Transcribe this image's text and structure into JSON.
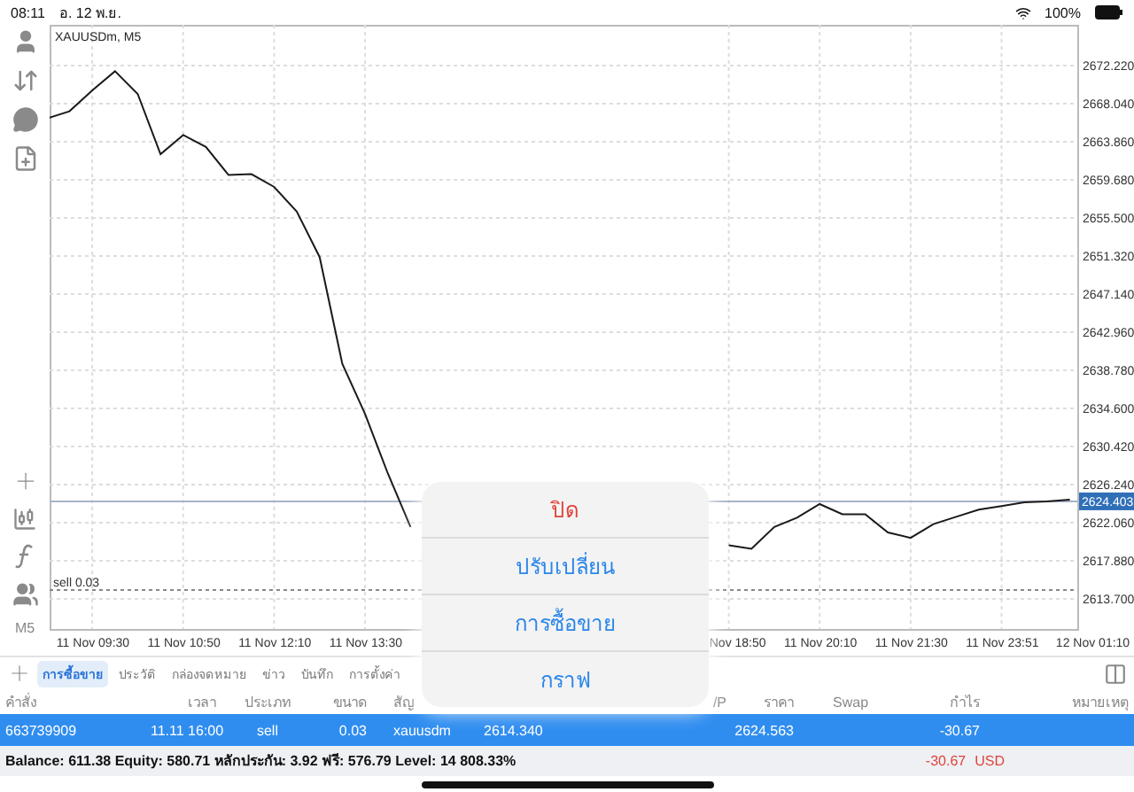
{
  "status_bar": {
    "time": "08:11",
    "date": "อ. 12 พ.ย.",
    "battery": "100%"
  },
  "toolbar": {
    "timeframe": "M5"
  },
  "chart": {
    "symbol_label": "XAUUSDm, M5",
    "chart_data": {
      "type": "line",
      "categories": [
        null,
        null,
        "11 Nov 09:30",
        null,
        null,
        null,
        "11 Nov 10:50",
        null,
        null,
        null,
        "11 Nov 12:10",
        null,
        null,
        null,
        "11 Nov 13:30",
        null,
        null,
        null,
        null,
        null,
        null,
        null,
        null,
        null,
        null,
        null,
        null,
        null,
        null,
        null,
        "Nov 18:50",
        null,
        null,
        null,
        "11 Nov 20:10",
        null,
        null,
        null,
        "11 Nov 21:30",
        null,
        null,
        null,
        "11 Nov 23:51",
        null,
        null,
        null,
        "12 Nov 01:10"
      ],
      "series": [
        {
          "color": "#1a1a1a",
          "values": [
            2666.4,
            2667.2,
            2669.5,
            2671.6,
            2669.1,
            2662.5,
            2664.6,
            2663.3,
            2660.2,
            2660.3,
            2658.9,
            2656.2,
            2651.2,
            2639.5,
            2634.0,
            2627.5,
            2621.6,
            null,
            null,
            null,
            null,
            null,
            null,
            null,
            null,
            null,
            null,
            null,
            null,
            null,
            2619.6,
            2619.2,
            2621.6,
            2622.6,
            2624.1,
            2623.0,
            2623.0,
            2621.0,
            2620.4,
            2621.9,
            2622.7,
            2623.5,
            2623.9,
            2624.3,
            2624.4,
            2624.6,
            null
          ]
        }
      ],
      "ylim": [
        2610.4,
        2676.69
      ],
      "yticks": [
        {
          "value": 2672.22,
          "label": "2672.220"
        },
        {
          "value": 2668.04,
          "label": "2668.040"
        },
        {
          "value": 2663.86,
          "label": "2663.860"
        },
        {
          "value": 2659.68,
          "label": "2659.680"
        },
        {
          "value": 2655.5,
          "label": "2655.500"
        },
        {
          "value": 2651.32,
          "label": "2651.320"
        },
        {
          "value": 2647.14,
          "label": "2647.140"
        },
        {
          "value": 2642.96,
          "label": "2642.960"
        },
        {
          "value": 2638.78,
          "label": "2638.780"
        },
        {
          "value": 2634.6,
          "label": "2634.600"
        },
        {
          "value": 2630.42,
          "label": "2630.420"
        },
        {
          "value": 2626.24,
          "label": "2626.240"
        },
        {
          "value": 2622.06,
          "label": "2622.060"
        },
        {
          "value": 2617.88,
          "label": "2617.880"
        },
        {
          "value": 2613.7,
          "label": "2613.700"
        }
      ],
      "grid": true,
      "ref_lines": [
        {
          "axis": "y",
          "value": 2624.403,
          "label": "2624.403"
        },
        {
          "axis": "y",
          "value": 2614.67,
          "label": "sell 0.03"
        }
      ]
    }
  },
  "bottom_tabs": [
    {
      "label": "การซื้อขาย",
      "selected": true
    },
    {
      "label": "ประวัติ",
      "selected": false
    },
    {
      "label": "กล่องจดหมาย",
      "selected": false
    },
    {
      "label": "ข่าว",
      "selected": false
    },
    {
      "label": "บันทึก",
      "selected": false
    },
    {
      "label": "การตั้งค่า",
      "selected": false
    }
  ],
  "table": {
    "columns": [
      "คำสั่ง",
      "เวลา",
      "ประเภท",
      "ขนาด",
      "สัญ",
      "",
      "",
      "/P",
      "ราคา",
      "Swap",
      "กำไร",
      "หมายเหตุ"
    ],
    "rows": [
      {
        "cells": [
          "663739909",
          "11.11 16:00",
          "sell",
          "0.03",
          "xauusdm",
          "2614.340",
          "",
          "",
          "2624.563",
          "",
          "-30.67",
          ""
        ],
        "selected": true
      }
    ]
  },
  "summary": {
    "text": "Balance: 611.38 Equity: 580.71 หลักประกัน: 3.92 ฟรี: 576.79 Level: 14 808.33%",
    "profit": "-30.67",
    "currency": "USD"
  },
  "action_menu": [
    {
      "label": "ปิด",
      "kind": "destructive"
    },
    {
      "label": "ปรับเปลี่ยน",
      "kind": "default"
    },
    {
      "label": "การซื้อขาย",
      "kind": "default"
    },
    {
      "label": "กราฟ",
      "kind": "default"
    }
  ]
}
